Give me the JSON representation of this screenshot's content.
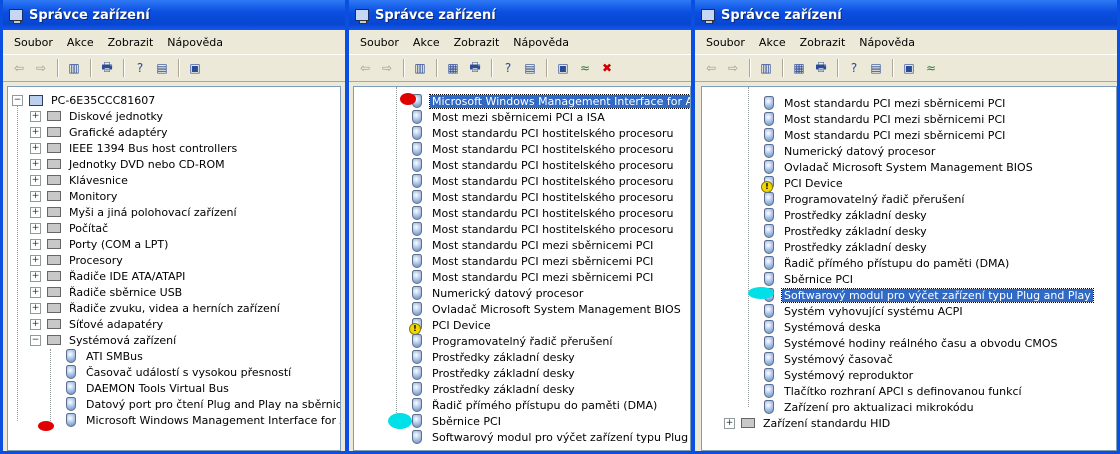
{
  "title": "Správce zařízení",
  "menu": [
    "Soubor",
    "Akce",
    "Zobrazit",
    "Nápověda"
  ],
  "toolbar_icons": [
    "back-arrow-icon",
    "forward-arrow-icon",
    "show-hide-tree-icon",
    "properties-icon",
    "print-icon",
    "help-icon",
    "view-icon",
    "scan-hardware-icon",
    "update-driver-icon",
    "uninstall-icon"
  ],
  "win1": {
    "root": "PC-6E35CCC81607",
    "categories": [
      "Diskové jednotky",
      "Grafické adaptéry",
      "IEEE 1394 Bus host controllers",
      "Jednotky DVD nebo CD-ROM",
      "Klávesnice",
      "Monitory",
      "Myši a jiná polohovací zařízení",
      "Počítač",
      "Porty (COM a LPT)",
      "Procesory",
      "Řadiče IDE ATA/ATAPI",
      "Řadiče sběrnice USB",
      "Řadiče zvuku, videa a herních zařízení",
      "Síťové adapatéry",
      "Systémová zařízení"
    ],
    "devices": [
      "ATI SMBus",
      "Časovač událostí s vysokou přesností",
      "DAEMON Tools Virtual Bus",
      "Datový port pro čtení Plug and Play na sběrnici ISA",
      "Microsoft Windows Management Interface for ACPI"
    ]
  },
  "win2": {
    "devices": [
      "Microsoft Windows Management Interface for ACPI",
      "Most mezi sběrnicemi PCI a ISA",
      "Most standardu PCI hostitelského procesoru",
      "Most standardu PCI hostitelského procesoru",
      "Most standardu PCI hostitelského procesoru",
      "Most standardu PCI hostitelského procesoru",
      "Most standardu PCI hostitelského procesoru",
      "Most standardu PCI hostitelského procesoru",
      "Most standardu PCI hostitelského procesoru",
      "Most standardu PCI mezi sběrnicemi PCI",
      "Most standardu PCI mezi sběrnicemi PCI",
      "Most standardu PCI mezi sběrnicemi PCI",
      "Numerický datový procesor",
      "Ovladač Microsoft System Management BIOS",
      "PCI Device",
      "Programovatelný řadič přerušení",
      "Prostředky základní desky",
      "Prostředky základní desky",
      "Prostředky základní desky",
      "Řadič přímého přístupu do paměti (DMA)",
      "Sběrnice PCI",
      "Softwarový modul pro výčet zařízení typu Plug and Pla"
    ]
  },
  "win3": {
    "devices": [
      "Most standardu PCI mezi sběrnicemi PCI",
      "Most standardu PCI mezi sběrnicemi PCI",
      "Most standardu PCI mezi sběrnicemi PCI",
      "Numerický datový procesor",
      "Ovladač Microsoft System Management BIOS",
      "PCI Device",
      "Programovatelný řadič přerušení",
      "Prostředky základní desky",
      "Prostředky základní desky",
      "Prostředky základní desky",
      "Řadič přímého přístupu do paměti (DMA)",
      "Sběrnice PCI",
      "Softwarový modul pro výčet zařízení typu Plug and Play",
      "Systém vyhovující systému ACPI",
      "Systémová deska",
      "Systémové hodiny reálného času a obvodu CMOS",
      "Systémový časovač",
      "Systémový reproduktor",
      "Tlačítko rozhraní APCI s definovanou funkcí",
      "Zařízení pro aktualizaci mikrokódu"
    ],
    "next_category": "Zařízení standardu HID"
  },
  "colors": {
    "selection": "#316ac5",
    "titlebar": "#0a4fe0",
    "marker_red": "#e00000",
    "marker_cyan": "#00e0e8"
  }
}
